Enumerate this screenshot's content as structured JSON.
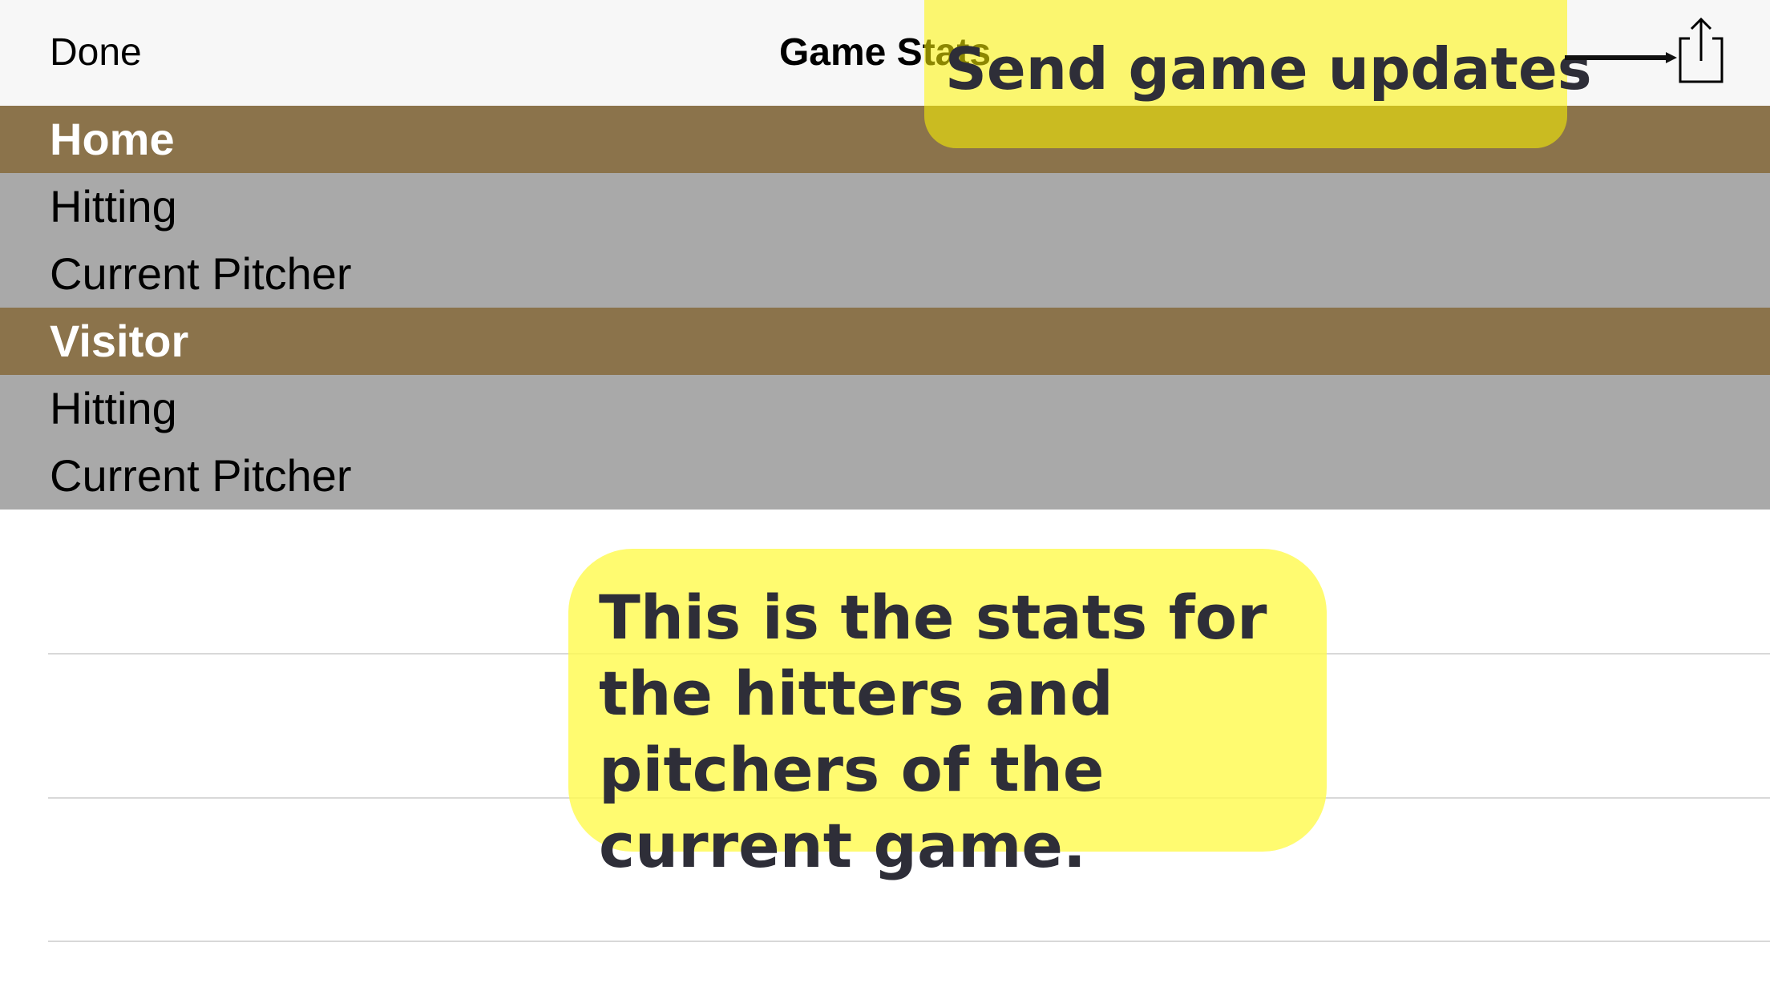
{
  "navbar": {
    "done_label": "Done",
    "title": "Game Stats",
    "share_icon": "share-icon"
  },
  "sections": [
    {
      "team": "Home",
      "rows": [
        "Hitting",
        "Current Pitcher"
      ]
    },
    {
      "team": "Visitor",
      "rows": [
        "Hitting",
        "Current Pitcher"
      ]
    }
  ],
  "callouts": {
    "top": "Send game updates",
    "main": "This is the stats for the hitters and pitchers of the current game."
  },
  "colors": {
    "team_header": "#8b734b",
    "sub_row": "#a9a9a9",
    "callout": "#fffa50"
  }
}
